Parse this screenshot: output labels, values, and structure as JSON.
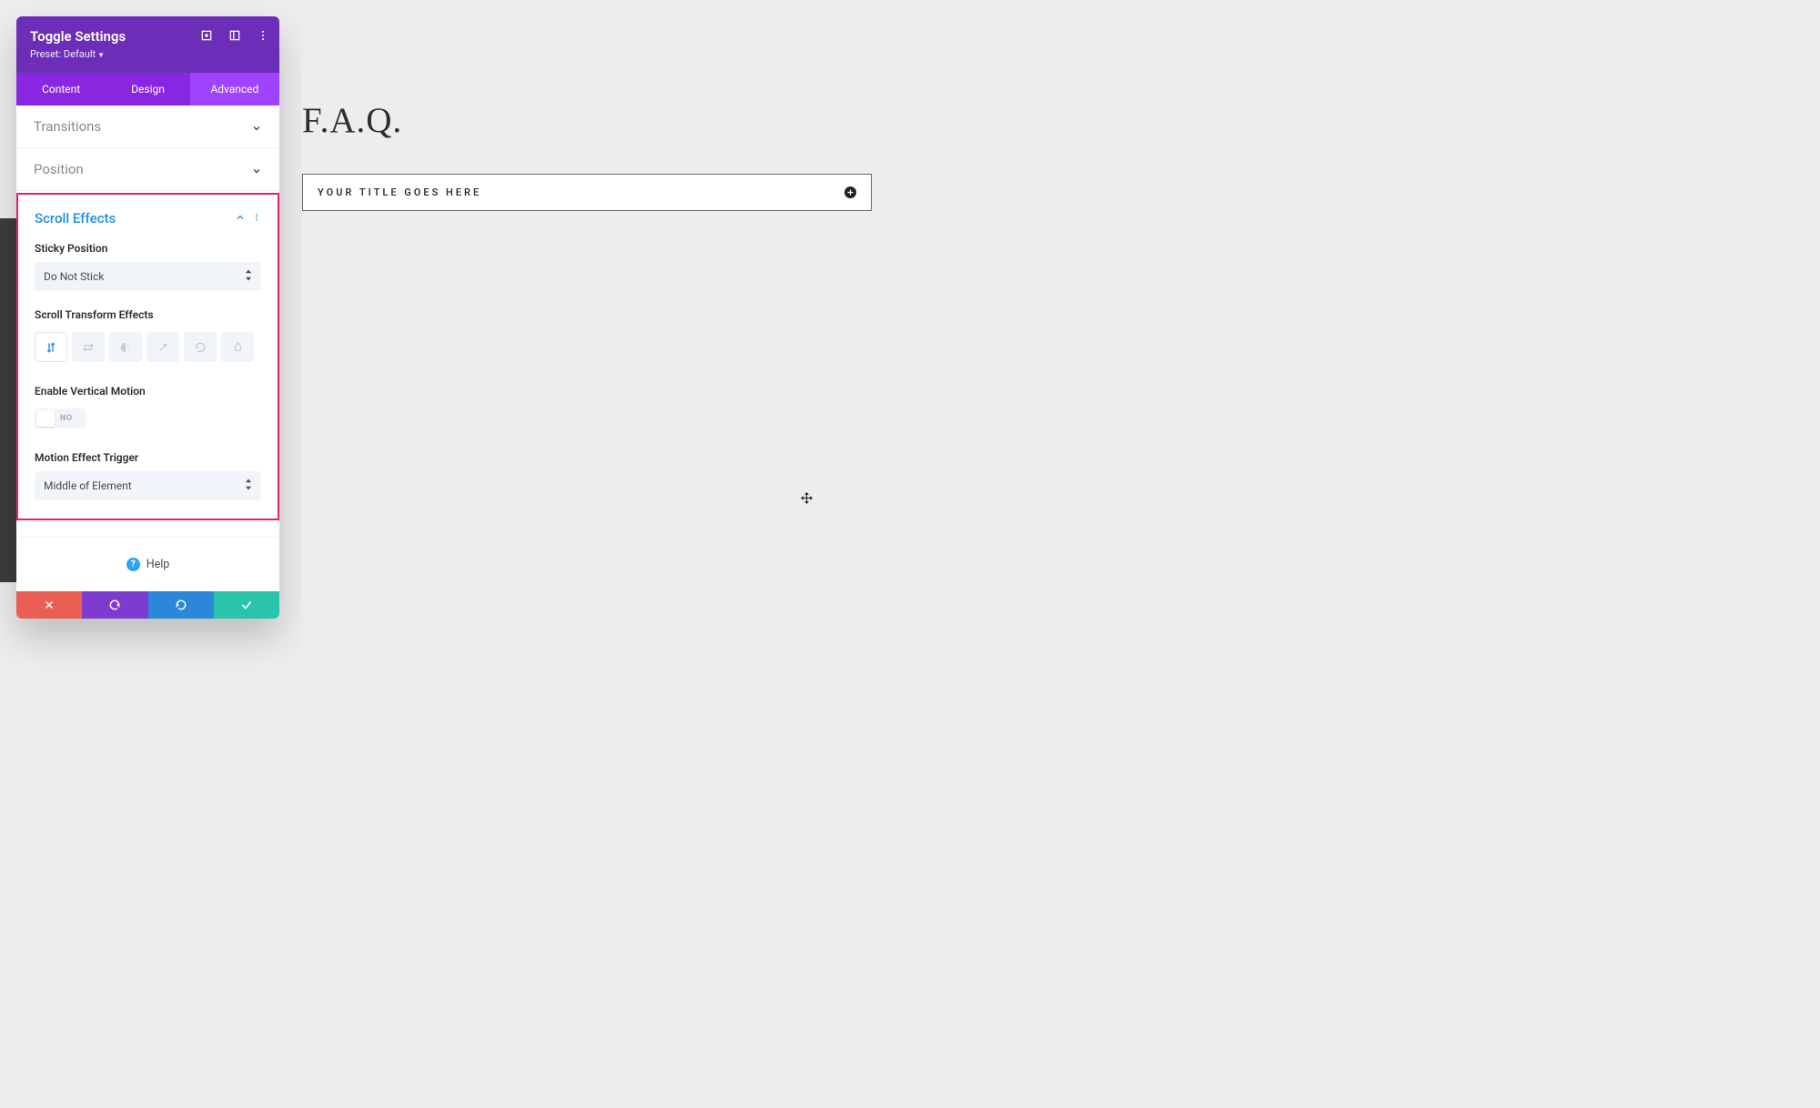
{
  "panel": {
    "title": "Toggle Settings",
    "preset_label": "Preset: Default"
  },
  "tabs": {
    "content": "Content",
    "design": "Design",
    "advanced": "Advanced"
  },
  "sections": {
    "transitions": "Transitions",
    "position": "Position",
    "scroll_effects": "Scroll Effects"
  },
  "fields": {
    "sticky_position_label": "Sticky Position",
    "sticky_position_value": "Do Not Stick",
    "scroll_transform_label": "Scroll Transform Effects",
    "enable_vertical_label": "Enable Vertical Motion",
    "enable_vertical_value": "NO",
    "motion_trigger_label": "Motion Effect Trigger",
    "motion_trigger_value": "Middle of Element"
  },
  "help": "Help",
  "canvas": {
    "heading": "F.A.Q.",
    "toggle_title": "YOUR TITLE GOES HERE"
  }
}
